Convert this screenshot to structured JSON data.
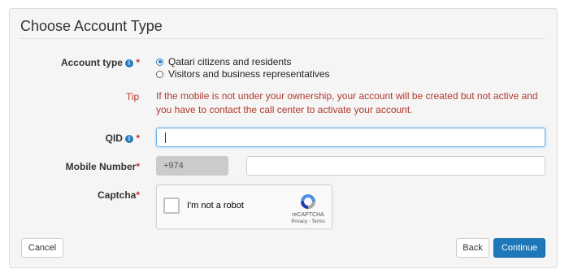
{
  "page": {
    "title": "Choose Account Type"
  },
  "account_type": {
    "label": "Account type",
    "required_mark": "*",
    "info_icon": "i",
    "options": [
      "Qatari citizens and residents",
      "Visitors and business representatives"
    ],
    "selected_index": 0
  },
  "tip": {
    "label": "Tip",
    "text": "If the mobile is not under your ownership, your account will be created but not active and you have to contact the call center to activate your account."
  },
  "qid": {
    "label": "QID",
    "required_mark": "*",
    "info_icon": "i",
    "value": ""
  },
  "mobile": {
    "label": "Mobile Number",
    "required_mark": "*",
    "prefix": "+974",
    "value": ""
  },
  "captcha": {
    "label": "Captcha",
    "required_mark": "*",
    "checkbox_text": "I'm not a robot",
    "brand": "reCAPTCHA",
    "links": "Privacy - Terms"
  },
  "buttons": {
    "cancel": "Cancel",
    "back": "Back",
    "continue": "Continue"
  },
  "colors": {
    "primary": "#1e77b8",
    "required": "#c0392b",
    "tip_text": "#b03a2e"
  }
}
